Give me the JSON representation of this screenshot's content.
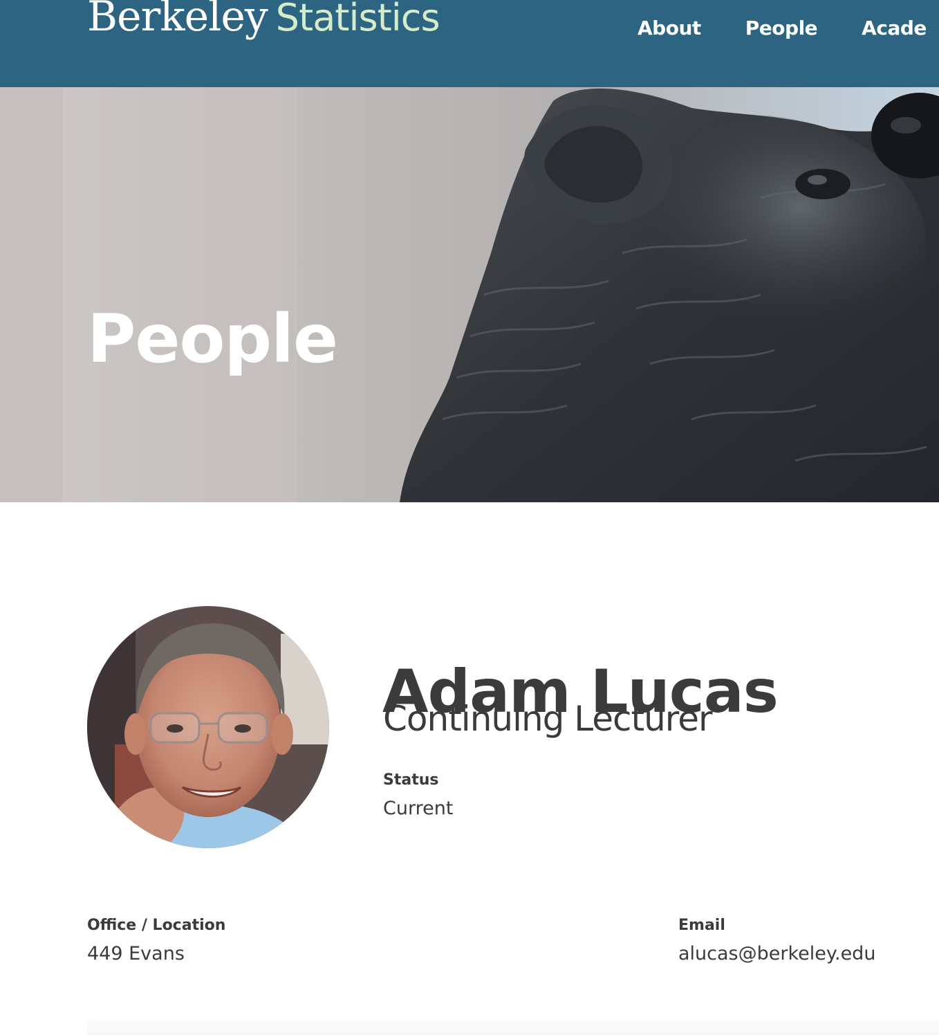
{
  "header": {
    "brand_main": "Berkeley",
    "brand_sub": "Statistics",
    "nav": [
      "About",
      "People",
      "Acade"
    ]
  },
  "hero": {
    "title": "People"
  },
  "profile": {
    "name": "Adam Lucas",
    "title": "Continuing Lecturer",
    "status_label": "Status",
    "status_value": "Current",
    "office_label": "Office / Location",
    "office_value": "449 Evans",
    "email_label": "Email",
    "email_value": "alucas@berkeley.edu"
  },
  "colors": {
    "header_bg": "#2c6481",
    "brand_accent": "#d4ecc9",
    "text_dark": "#3b3b3b"
  }
}
